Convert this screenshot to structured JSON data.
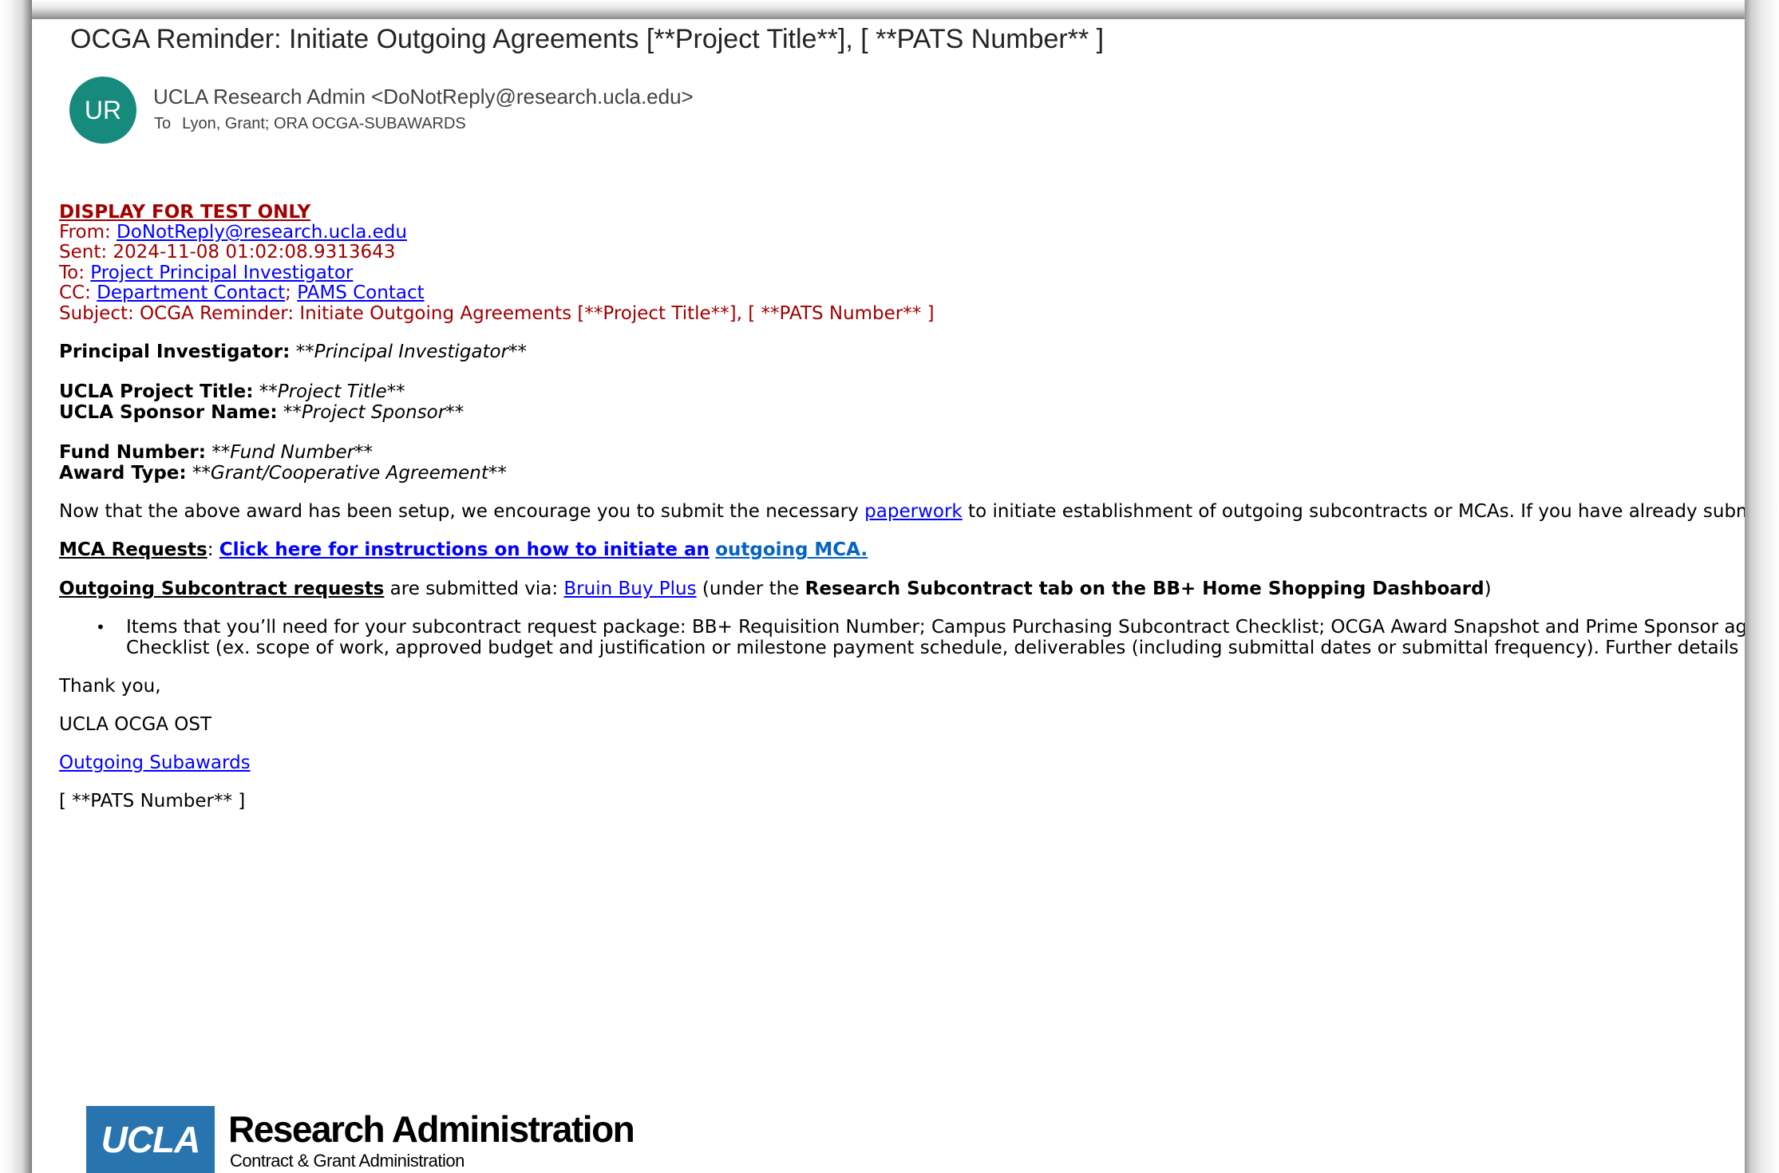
{
  "header": {
    "subject": "OCGA Reminder: Initiate Outgoing Agreements [**Project Title**], [ **PATS Number** ]",
    "avatar_initials": "UR",
    "sender": "UCLA Research Admin <DoNotReply@research.ucla.edu>",
    "to_label": "To",
    "recipients": "Lyon, Grant; ORA OCGA-SUBAWARDS"
  },
  "banner": {
    "test_label": "DISPLAY FOR TEST ONLY",
    "from_label": "From: ",
    "from_value": "DoNotReply@research.ucla.edu",
    "sent": "Sent: 2024-11-08 01:02:08.9313643",
    "to_label": "To: ",
    "to_value": "Project Principal Investigator",
    "cc_label": "CC: ",
    "cc_value1": "Department Contact",
    "cc_sep": ";",
    "cc_value2": "PAMS Contact",
    "subject": "Subject: OCGA Reminder: Initiate Outgoing Agreements [**Project Title**], [ **PATS Number** ]"
  },
  "fields": {
    "pi_label": "Principal Investigator:",
    "pi_value": "**Principal Investigator**",
    "title_label": "UCLA Project Title:",
    "title_value": "**Project Title**",
    "sponsor_label": "UCLA Sponsor Name:",
    "sponsor_value": "**Project Sponsor**",
    "fund_label": "Fund Number:",
    "fund_value": "**Fund Number**",
    "award_label": "Award Type:",
    "award_value": "**Grant/Cooperative Agreement**"
  },
  "intro": {
    "before": "Now that the above award has been setup, we encourage you to submit the necessary ",
    "link": "paperwork",
    "after": " to initiate establishment of outgoing subcontracts or MCAs. If you have already submitt"
  },
  "mca": {
    "label": "MCA Requests",
    "colon": ": ",
    "link1": "Click here for instructions on how to initiate an",
    "link2": "outgoing MCA."
  },
  "subcontract": {
    "label": "Outgoing Subcontract requests",
    "middle": " are submitted via: ",
    "link": "Bruin Buy Plus",
    "paren_open": " (under the ",
    "bold": "Research Subcontract tab on the BB+ Home Shopping Dashboard",
    "paren_close": ")"
  },
  "bullet": {
    "dot": "•",
    "line1": "Items that you’ll need for your subcontract request package: BB+ Requisition Number; Campus Purchasing Subcontract Checklist; OCGA Award Snapshot and Prime Sponsor agree",
    "line2": "Checklist (ex. scope of work, approved budget and justification or milestone payment schedule, deliverables (including submittal dates or submittal frequency). Further details reg"
  },
  "closing": {
    "thanks": "Thank you,",
    "team": "UCLA OCGA OST",
    "link": "Outgoing Subawards",
    "pats": "[ **PATS Number** ]"
  },
  "logo": {
    "box_text": "UCLA",
    "title": "Research Administration",
    "subtitle": "Contract & Grant Administration"
  },
  "colors": {
    "avatar": "#178a7e",
    "test_red": "#a10000",
    "link": "#0000ff",
    "ucla_blue": "#2774ae"
  }
}
